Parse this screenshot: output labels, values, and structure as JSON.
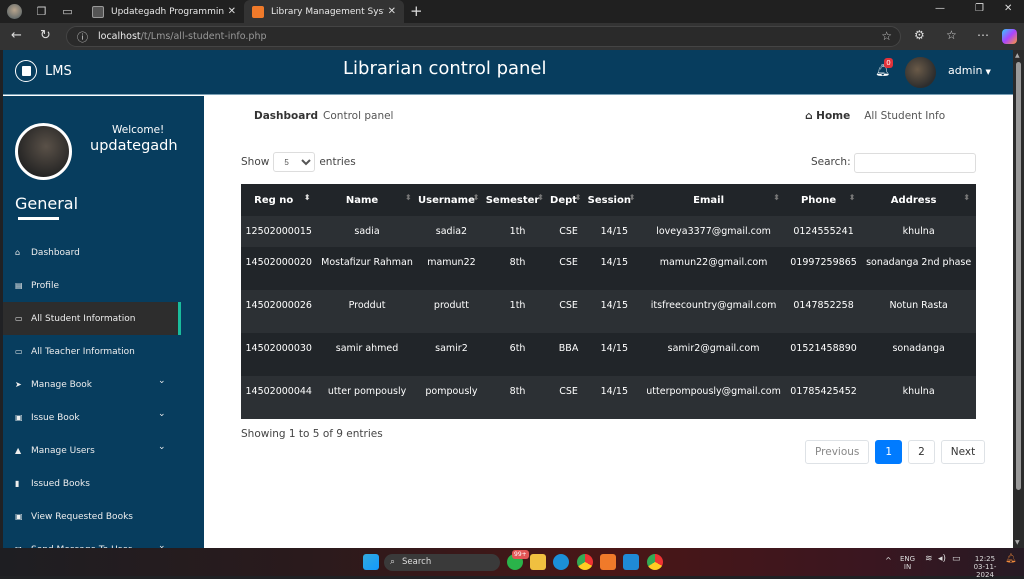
{
  "browser": {
    "tabs": [
      {
        "label": "Updategadh Programming - Upd",
        "active": false
      },
      {
        "label": "Library Management System",
        "active": true
      }
    ],
    "url_host": "localhost",
    "url_path": "/t/Lms/all-student-info.php"
  },
  "header": {
    "brand": "LMS",
    "title": "Librarian control panel",
    "notification_count": "0",
    "user_menu": "admin"
  },
  "sidebar": {
    "welcome": "Welcome!",
    "username": "updategadh",
    "section_title": "General",
    "items": [
      {
        "label": "Dashboard",
        "icon": "home-icon",
        "glyph": "⌂",
        "expandable": false,
        "active": false
      },
      {
        "label": "Profile",
        "icon": "id-card-icon",
        "glyph": "▤",
        "expandable": false,
        "active": false
      },
      {
        "label": "All Student Information",
        "icon": "monitor-icon",
        "glyph": "▭",
        "expandable": false,
        "active": true
      },
      {
        "label": "All Teacher Information",
        "icon": "monitor-icon",
        "glyph": "▭",
        "expandable": false,
        "active": false
      },
      {
        "label": "Manage Book",
        "icon": "paper-plane-icon",
        "glyph": "➤",
        "expandable": true,
        "active": false
      },
      {
        "label": "Issue Book",
        "icon": "book-icon",
        "glyph": "▣",
        "expandable": true,
        "active": false
      },
      {
        "label": "Manage Users",
        "icon": "users-icon",
        "glyph": "▲",
        "expandable": true,
        "active": false
      },
      {
        "label": "Issued Books",
        "icon": "bookmark-icon",
        "glyph": "▮",
        "expandable": false,
        "active": false
      },
      {
        "label": "View Requested Books",
        "icon": "book-icon",
        "glyph": "▣",
        "expandable": false,
        "active": false
      },
      {
        "label": "Send Message To User",
        "icon": "message-icon",
        "glyph": "✉",
        "expandable": true,
        "active": false
      }
    ]
  },
  "breadcrumb": {
    "left_title": "Dashboard",
    "left_sub": "Control panel",
    "home": "Home",
    "current": "All Student Info"
  },
  "table_controls": {
    "show_label": "Show",
    "entries_label": "entries",
    "page_size": "5",
    "search_label": "Search:",
    "search_value": ""
  },
  "table": {
    "columns": [
      "Reg no",
      "Name",
      "Username",
      "Semester",
      "Dept",
      "Session",
      "Email",
      "Phone",
      "Address"
    ],
    "sorted_column": "Reg no",
    "rows": [
      [
        "12502000015",
        "sadia",
        "sadia2",
        "1th",
        "CSE",
        "14/15",
        "loveya3377@gmail.com",
        "0124555241",
        "khulna"
      ],
      [
        "14502000020",
        "Mostafizur Rahman",
        "mamun22",
        "8th",
        "CSE",
        "14/15",
        "mamun22@gmail.com",
        "01997259865",
        "sonadanga 2nd phase"
      ],
      [
        "14502000026",
        "Proddut",
        "produtt",
        "1th",
        "CSE",
        "14/15",
        "itsfreecountry@gmail.com",
        "0147852258",
        "Notun Rasta"
      ],
      [
        "14502000030",
        "samir ahmed",
        "samir2",
        "6th",
        "BBA",
        "14/15",
        "samir2@gmail.com",
        "01521458890",
        "sonadanga"
      ],
      [
        "14502000044",
        "utter pompously",
        "pompously",
        "8th",
        "CSE",
        "14/15",
        "utterpompously@gmail.com",
        "01785425452",
        "khulna"
      ]
    ]
  },
  "footer": {
    "info": "Showing 1 to 5 of 9 entries",
    "previous": "Previous",
    "pages": [
      "1",
      "2"
    ],
    "current_page": "1",
    "next": "Next"
  },
  "taskbar": {
    "search": "Search",
    "badge": "99+",
    "lang_top": "ENG",
    "lang_bottom": "IN",
    "time": "12:25",
    "date": "03-11-2024"
  }
}
